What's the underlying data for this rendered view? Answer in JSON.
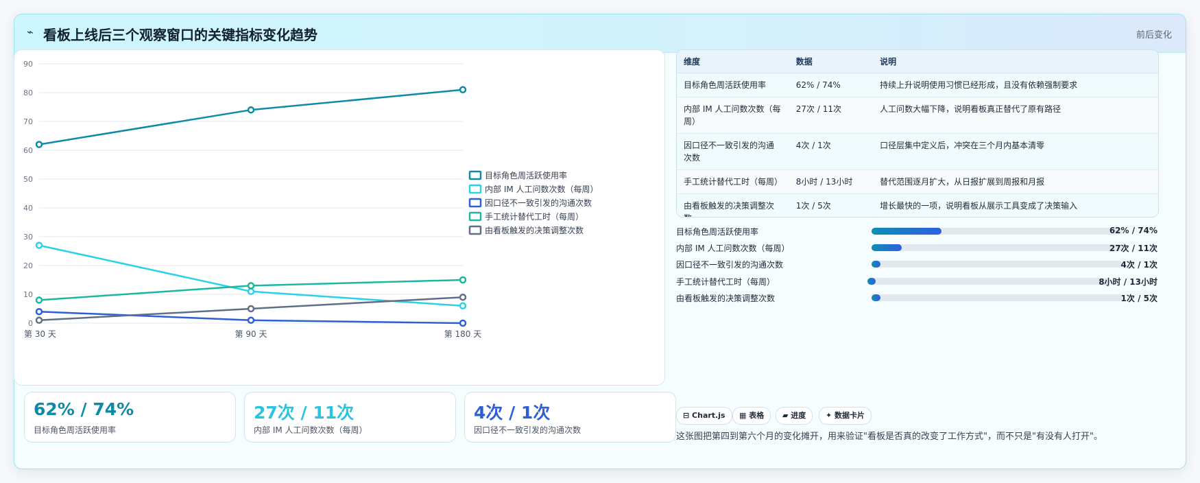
{
  "header": {
    "icon": "⌁",
    "title": "看板上线后三个观察窗口的关键指标变化趋势",
    "right_label": "前后变化"
  },
  "chart_data": {
    "type": "line",
    "x": [
      "第 30 天",
      "第 90 天",
      "第 180 天"
    ],
    "ylim": [
      0,
      90
    ],
    "yticks": [
      0,
      10,
      20,
      30,
      40,
      50,
      60,
      70,
      80,
      90
    ],
    "grid": true,
    "legend_position": "right",
    "series": [
      {
        "name": "目标角色周活跃使用率",
        "values": [
          62,
          74,
          81
        ],
        "color": "#0e8aa8"
      },
      {
        "name": "内部 IM 人工问数次数（每周）",
        "values": [
          27,
          11,
          6
        ],
        "color": "#2bd0ea"
      },
      {
        "name": "因口径不一致引发的沟通次数",
        "values": [
          4,
          1,
          0
        ],
        "color": "#2d5fd6"
      },
      {
        "name": "手工统计替代工时（每周）",
        "values": [
          8,
          13,
          15
        ],
        "color": "#1ab8a0"
      },
      {
        "name": "由看板触发的决策调整次数",
        "values": [
          1,
          5,
          9
        ],
        "color": "#5f6f86"
      }
    ]
  },
  "kpis": [
    {
      "value": "62% / 74%",
      "label": "目标角色周活跃使用率",
      "color": "#0e8aa8"
    },
    {
      "value": "27次 / 11次",
      "label": "内部 IM 人工问数次数（每周）",
      "color": "#2bc4e0"
    },
    {
      "value": "4次 / 1次",
      "label": "因口径不一致引发的沟通次数",
      "color": "#2d5fd6"
    }
  ],
  "table": {
    "headers": [
      "维度",
      "数据",
      "说明"
    ],
    "rows": [
      [
        "目标角色周活跃使用率",
        "62% / 74%",
        "持续上升说明使用习惯已经形成，且没有依赖强制要求"
      ],
      [
        "内部 IM 人工问数次数（每周）",
        "27次 / 11次",
        "人工问数大幅下降，说明看板真正替代了原有路径"
      ],
      [
        "因口径不一致引发的沟通次数",
        "4次 / 1次",
        "口径层集中定义后，冲突在三个月内基本清零"
      ],
      [
        "手工统计替代工时（每周）",
        "8小时 / 13小时",
        "替代范围逐月扩大，从日报扩展到周报和月报"
      ],
      [
        "由看板触发的决策调整次数",
        "1次 / 5次",
        "增长最快的一项，说明看板从展示工具变成了决策输入"
      ]
    ]
  },
  "progress": [
    {
      "label": "目标角色周活跃使用率",
      "value": "62% / 74%",
      "fraction": 0.28
    },
    {
      "label": "内部 IM 人工问数次数（每周）",
      "value": "27次 / 11次",
      "fraction": 0.12
    },
    {
      "label": "因口径不一致引发的沟通次数",
      "value": "4次 / 1次",
      "fraction": 0.035
    },
    {
      "label": "手工统计替代工时（每周）",
      "value": "8小时 / 13小时",
      "fraction": 0.035
    },
    {
      "label": "由看板触发的决策调整次数",
      "value": "1次 / 5次",
      "fraction": 0.035
    }
  ],
  "tags": [
    "⊟ Chart.js",
    "▦ 表格",
    "▰ 进度",
    "✦ 数据卡片"
  ],
  "note": "这张图把第四到第六个月的变化摊开，用来验证\"看板是否真的改变了工作方式\"，而不只是\"有没有人打开\"。"
}
